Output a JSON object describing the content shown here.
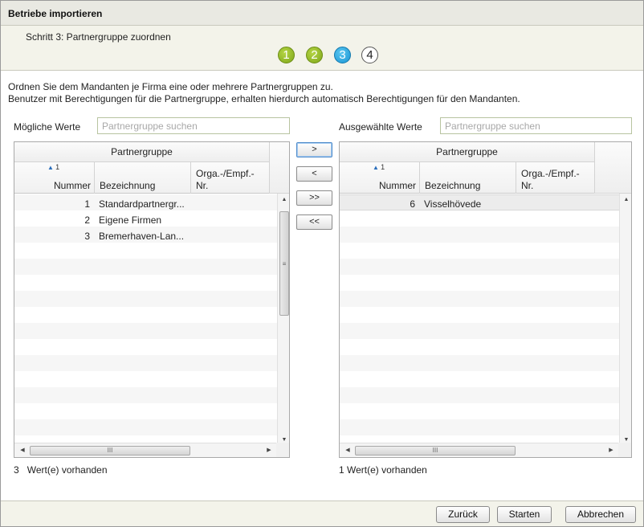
{
  "window": {
    "title": "Betriebe importieren"
  },
  "wizard": {
    "step_label": "Schritt 3: Partnergruppe zuordnen",
    "steps": [
      "1",
      "2",
      "3",
      "4"
    ],
    "current_step": 3
  },
  "description": {
    "line1": "Ordnen Sie dem Mandanten je Firma eine oder mehrere Partnergruppen zu.",
    "line2": "Benutzer mit Berechtigungen für die Partnergruppe, erhalten hierdurch automatisch Berechtigungen für den Mandanten."
  },
  "left": {
    "label": "Mögliche Werte",
    "search_placeholder": "Partnergruppe suchen",
    "group_header": "Partnergruppe",
    "sort_indicator": "1",
    "columns": {
      "nummer": "Nummer",
      "bezeichnung": "Bezeichnung",
      "orga_line1": "Orga.-/Empf.-",
      "orga_line2": "Nr."
    },
    "rows": [
      {
        "nummer": "1",
        "bezeichnung": "Standardpartnergr...",
        "orga": ""
      },
      {
        "nummer": "2",
        "bezeichnung": "Eigene Firmen",
        "orga": ""
      },
      {
        "nummer": "3",
        "bezeichnung": "Bremerhaven-Lan...",
        "orga": ""
      }
    ],
    "count_number": "3",
    "count_text": "Wert(e) vorhanden"
  },
  "right": {
    "label": "Ausgewählte Werte",
    "search_placeholder": "Partnergruppe suchen",
    "group_header": "Partnergruppe",
    "sort_indicator": "1",
    "columns": {
      "nummer": "Nummer",
      "bezeichnung": "Bezeichnung",
      "orga_line1": "Orga.-/Empf.-",
      "orga_line2": "Nr."
    },
    "rows": [
      {
        "nummer": "6",
        "bezeichnung": "Visselhövede",
        "orga": ""
      }
    ],
    "count_text": "1 Wert(e) vorhanden"
  },
  "transfer": {
    "add": ">",
    "remove": "<",
    "add_all": ">>",
    "remove_all": "<<"
  },
  "footer": {
    "back": "Zurück",
    "start": "Starten",
    "cancel": "Abbrechen"
  },
  "colors": {
    "step_done": "#8cb520",
    "step_active": "#2aa7e0",
    "header_bg": "#e9e9e2",
    "panel_bg": "#f3f3ea"
  }
}
